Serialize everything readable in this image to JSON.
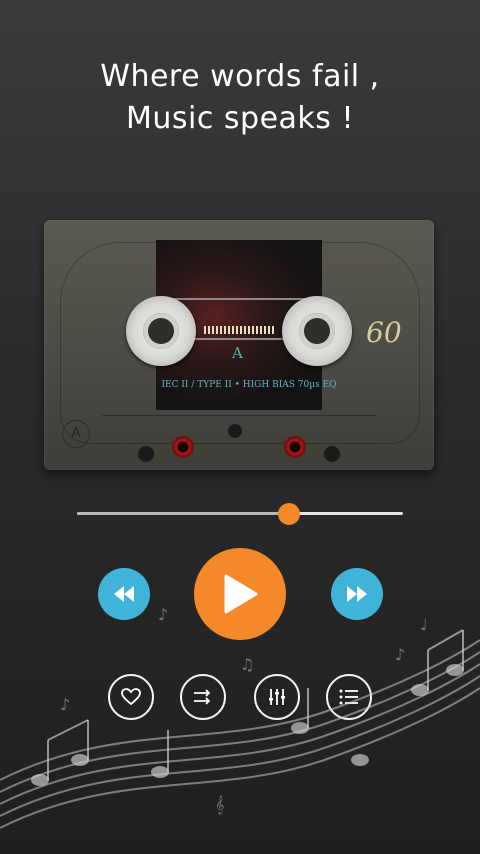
{
  "header": {
    "quote_line1": "Where words fail ,",
    "quote_line2": "Music speaks !"
  },
  "cassette": {
    "brand_number": "60",
    "side_letter": "A",
    "spec_text": "IEC II / TYPE II • HIGH BIAS 70µs EQ",
    "side_badge": "A"
  },
  "player": {
    "progress_fraction": 0.65,
    "controls": {
      "rewind": "rewind-icon",
      "play": "play-icon",
      "forward": "fast-forward-icon"
    },
    "actions": [
      "heart-icon",
      "shuffle-icon",
      "equalizer-icon",
      "playlist-icon"
    ]
  },
  "colors": {
    "accent_orange": "#f5892a",
    "accent_blue": "#3fb4d8",
    "background": "#2b2b2b"
  }
}
